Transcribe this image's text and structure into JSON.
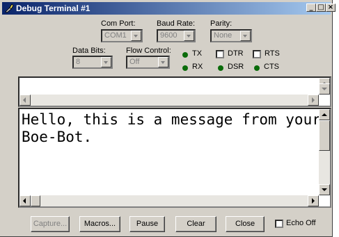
{
  "window": {
    "title": "Debug Terminal #1"
  },
  "title_buttons": {
    "minimize": "_",
    "maximize": "□",
    "close": "×"
  },
  "settings": {
    "com_port": {
      "label": "Com Port:",
      "value": "COM1"
    },
    "baud_rate": {
      "label": "Baud Rate:",
      "value": "9600"
    },
    "parity": {
      "label": "Parity:",
      "value": "None"
    },
    "data_bits": {
      "label": "Data Bits:",
      "value": "8"
    },
    "flow_control": {
      "label": "Flow Control:",
      "value": "Off"
    }
  },
  "indicators": {
    "tx": "TX",
    "rx": "RX",
    "dsr": "DSR",
    "cts": "CTS",
    "dtr": "DTR",
    "rts": "RTS",
    "led_color": "#0a6b0a"
  },
  "receive_text": "Hello, this is a message from your Boe-Bot.",
  "buttons": {
    "capture": "Capture...",
    "macros": "Macros...",
    "pause": "Pause",
    "clear": "Clear",
    "close": "Close",
    "echo_off": "Echo Off"
  },
  "colors": {
    "titlebar_start": "#0a246a",
    "titlebar_end": "#a6caf0",
    "face": "#d4d0c8"
  }
}
